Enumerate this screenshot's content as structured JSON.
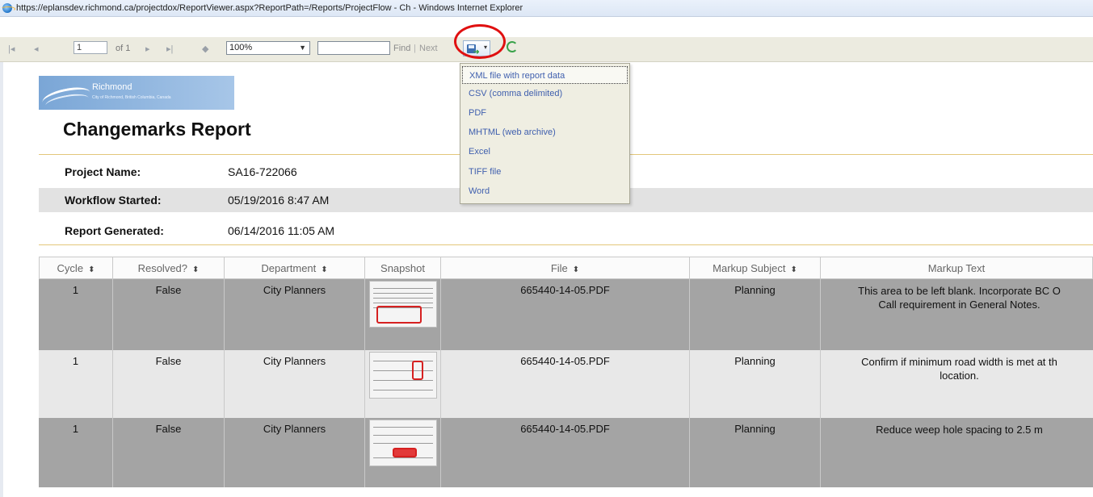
{
  "window": {
    "title": "https://eplansdev.richmond.ca/projectdox/ReportViewer.aspx?ReportPath=/Reports/ProjectFlow - Ch - Windows Internet Explorer"
  },
  "toolbar": {
    "page_value": "1",
    "of_label": "of 1",
    "zoom_value": "100%",
    "find_label": "Find",
    "find_separator": "|",
    "next_label": "Next"
  },
  "export_menu": {
    "items": [
      "XML file with report data",
      "CSV (comma delimited)",
      "PDF",
      "MHTML (web archive)",
      "Excel",
      "TIFF file",
      "Word"
    ]
  },
  "logo": {
    "name": "Richmond",
    "subtitle": "City of Richmond, British Columbia, Canada"
  },
  "report": {
    "title": "Changemarks Report",
    "fields": [
      {
        "label": "Project Name:",
        "value": "SA16-722066"
      },
      {
        "label": "Workflow Started:",
        "value": "05/19/2016  8:47 AM"
      },
      {
        "label": "Report Generated:",
        "value": "06/14/2016 11:05 AM"
      }
    ]
  },
  "table": {
    "sort_icon": "sort-arrows-icon",
    "headers": [
      "Cycle",
      "Resolved?",
      "Department",
      "Snapshot",
      "File",
      "Markup Subject",
      "Markup Text"
    ],
    "rows": [
      {
        "cycle": "1",
        "resolved": "False",
        "department": "City Planners",
        "file": "665440-14-05.PDF",
        "subject": "Planning",
        "text_line1": "This area to be left blank. Incorporate BC O",
        "text_line2": "Call requirement in General Notes."
      },
      {
        "cycle": "1",
        "resolved": "False",
        "department": "City Planners",
        "file": "665440-14-05.PDF",
        "subject": "Planning",
        "text_line1": "Confirm if minimum road width is met at th",
        "text_line2": "location."
      },
      {
        "cycle": "1",
        "resolved": "False",
        "department": "City Planners",
        "file": "665440-14-05.PDF",
        "subject": "Planning",
        "text_line1": "Reduce weep hole spacing to 2.5 m",
        "text_line2": ""
      }
    ]
  },
  "colors": {
    "annotation_circle": "#e01010",
    "row_dark": "#a4a4a4",
    "row_light": "#e8e8e8",
    "menu_text": "#3f5fae",
    "rule": "#e3c77a"
  }
}
